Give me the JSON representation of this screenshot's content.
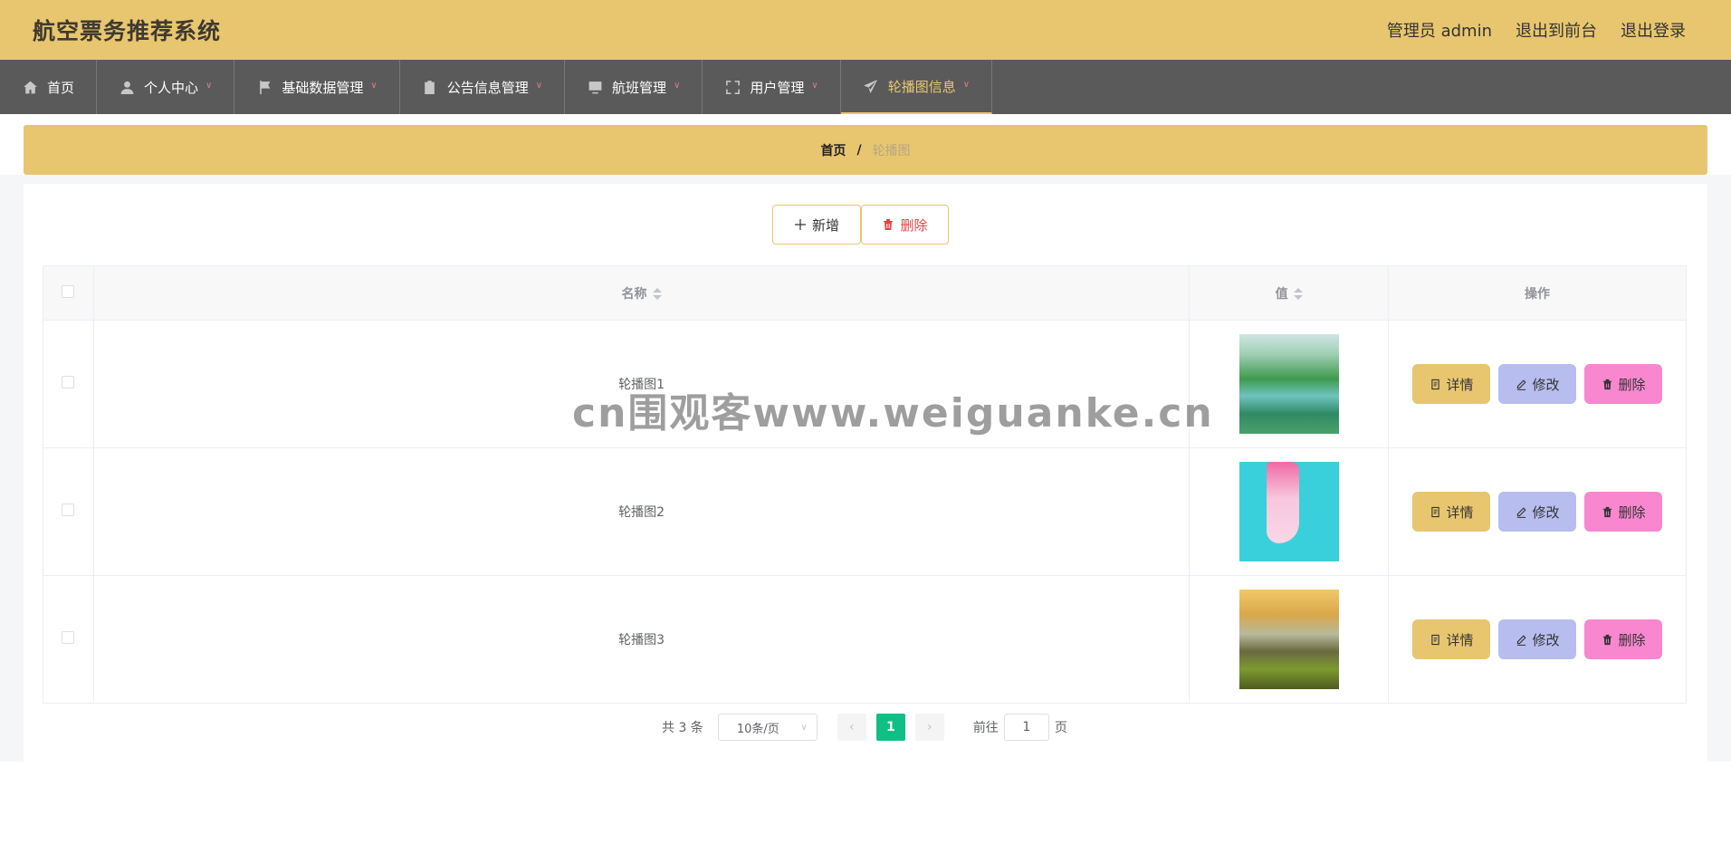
{
  "header": {
    "title": "航空票务推荐系统",
    "admin_label": "管理员 admin",
    "exit_front": "退出到前台",
    "logout": "退出登录"
  },
  "nav": {
    "items": [
      {
        "label": "首页",
        "icon": "home-icon"
      },
      {
        "label": "个人中心",
        "icon": "user-icon"
      },
      {
        "label": "基础数据管理",
        "icon": "flag-icon"
      },
      {
        "label": "公告信息管理",
        "icon": "clipboard-icon"
      },
      {
        "label": "航班管理",
        "icon": "monitor-icon"
      },
      {
        "label": "用户管理",
        "icon": "fullscreen-icon"
      },
      {
        "label": "轮播图信息",
        "icon": "send-icon"
      }
    ]
  },
  "breadcrumb": {
    "home": "首页",
    "sep": "/",
    "current": "轮播图"
  },
  "toolbar": {
    "add_label": "新增",
    "delete_label": "删除"
  },
  "table": {
    "headers": {
      "name": "名称",
      "value": "值",
      "actions": "操作"
    },
    "rows": [
      {
        "name": "轮播图1",
        "thumb": "landscape-river"
      },
      {
        "name": "轮播图2",
        "thumb": "pink-figure-cyan"
      },
      {
        "name": "轮播图3",
        "thumb": "sunset-road"
      }
    ],
    "actions": {
      "detail": "详情",
      "edit": "修改",
      "delete": "删除"
    }
  },
  "pagination": {
    "total_text": "共 3 条",
    "page_size": "10条/页",
    "current_page": "1",
    "goto_prefix": "前往",
    "goto_value": "1",
    "goto_suffix": "页"
  },
  "watermark": "cn围观客www.weiguanke.cn",
  "colors": {
    "accent": "#e8c670",
    "nav_bg": "#5a5a5a",
    "page_active": "#0fbf84",
    "edit": "#b7bdee",
    "delete": "#f887cf"
  }
}
